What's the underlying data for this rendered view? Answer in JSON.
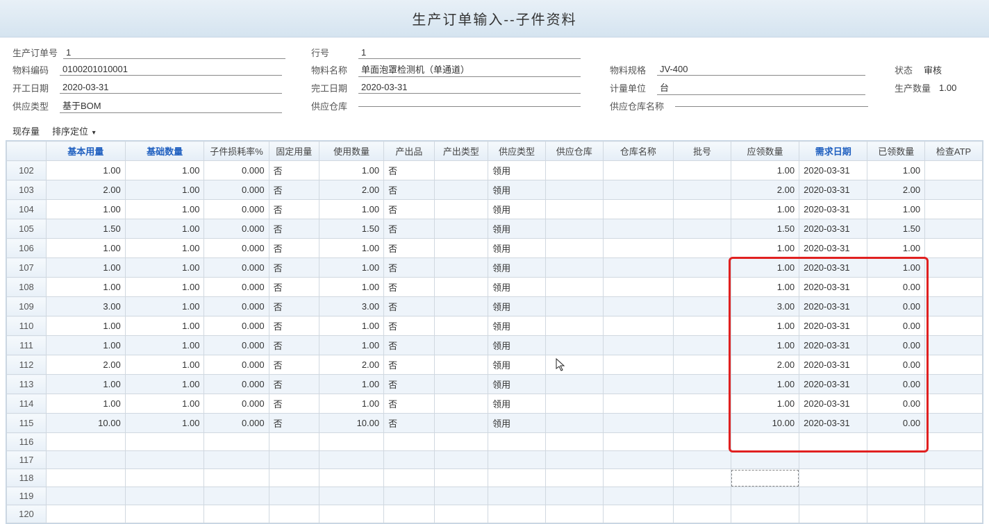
{
  "title": "生产订单输入--子件资料",
  "form": {
    "order_no_label": "生产订单号",
    "order_no": "1",
    "line_no_label": "行号",
    "line_no": "1",
    "mat_code_label": "物料编码",
    "mat_code": "0100201010001",
    "mat_name_label": "物料名称",
    "mat_name": "单面泡罩检测机（单通道）",
    "mat_spec_label": "物料规格",
    "mat_spec": "JV-400",
    "status_label": "状态",
    "status": "审核",
    "start_date_label": "开工日期",
    "start_date": "2020-03-31",
    "end_date_label": "完工日期",
    "end_date": "2020-03-31",
    "unit_label": "计量单位",
    "unit": "台",
    "qty_label": "生产数量",
    "qty": "1.00",
    "supply_type_label": "供应类型",
    "supply_type": "基于BOM",
    "supply_wh_label": "供应仓库",
    "supply_wh": "",
    "supply_wh_name_label": "供应仓库名称",
    "supply_wh_name": ""
  },
  "toolbar": {
    "stock": "现存量",
    "sort": "排序定位"
  },
  "columns": {
    "c0": "",
    "c1": "基本用量",
    "c2": "基础数量",
    "c3": "子件损耗率%",
    "c4": "固定用量",
    "c5": "使用数量",
    "c6": "产出品",
    "c7": "产出类型",
    "c8": "供应类型",
    "c9": "供应仓库",
    "c10": "仓库名称",
    "c11": "批号",
    "c12": "应领数量",
    "c13": "需求日期",
    "c14": "已领数量",
    "c15": "检查ATP"
  },
  "rows": [
    {
      "n": "102",
      "base": "1.00",
      "bqty": "1.00",
      "loss": "0.000",
      "fix": "否",
      "use": "1.00",
      "out": "否",
      "ot": "",
      "st": "领用",
      "wh": "",
      "wn": "",
      "lot": "",
      "req": "1.00",
      "date": "2020-03-31",
      "got": "1.00",
      "atp": ""
    },
    {
      "n": "103",
      "base": "2.00",
      "bqty": "1.00",
      "loss": "0.000",
      "fix": "否",
      "use": "2.00",
      "out": "否",
      "ot": "",
      "st": "领用",
      "wh": "",
      "wn": "",
      "lot": "",
      "req": "2.00",
      "date": "2020-03-31",
      "got": "2.00",
      "atp": ""
    },
    {
      "n": "104",
      "base": "1.00",
      "bqty": "1.00",
      "loss": "0.000",
      "fix": "否",
      "use": "1.00",
      "out": "否",
      "ot": "",
      "st": "领用",
      "wh": "",
      "wn": "",
      "lot": "",
      "req": "1.00",
      "date": "2020-03-31",
      "got": "1.00",
      "atp": ""
    },
    {
      "n": "105",
      "base": "1.50",
      "bqty": "1.00",
      "loss": "0.000",
      "fix": "否",
      "use": "1.50",
      "out": "否",
      "ot": "",
      "st": "领用",
      "wh": "",
      "wn": "",
      "lot": "",
      "req": "1.50",
      "date": "2020-03-31",
      "got": "1.50",
      "atp": ""
    },
    {
      "n": "106",
      "base": "1.00",
      "bqty": "1.00",
      "loss": "0.000",
      "fix": "否",
      "use": "1.00",
      "out": "否",
      "ot": "",
      "st": "领用",
      "wh": "",
      "wn": "",
      "lot": "",
      "req": "1.00",
      "date": "2020-03-31",
      "got": "1.00",
      "atp": ""
    },
    {
      "n": "107",
      "base": "1.00",
      "bqty": "1.00",
      "loss": "0.000",
      "fix": "否",
      "use": "1.00",
      "out": "否",
      "ot": "",
      "st": "领用",
      "wh": "",
      "wn": "",
      "lot": "",
      "req": "1.00",
      "date": "2020-03-31",
      "got": "1.00",
      "atp": ""
    },
    {
      "n": "108",
      "base": "1.00",
      "bqty": "1.00",
      "loss": "0.000",
      "fix": "否",
      "use": "1.00",
      "out": "否",
      "ot": "",
      "st": "领用",
      "wh": "",
      "wn": "",
      "lot": "",
      "req": "1.00",
      "date": "2020-03-31",
      "got": "0.00",
      "atp": ""
    },
    {
      "n": "109",
      "base": "3.00",
      "bqty": "1.00",
      "loss": "0.000",
      "fix": "否",
      "use": "3.00",
      "out": "否",
      "ot": "",
      "st": "领用",
      "wh": "",
      "wn": "",
      "lot": "",
      "req": "3.00",
      "date": "2020-03-31",
      "got": "0.00",
      "atp": ""
    },
    {
      "n": "110",
      "base": "1.00",
      "bqty": "1.00",
      "loss": "0.000",
      "fix": "否",
      "use": "1.00",
      "out": "否",
      "ot": "",
      "st": "领用",
      "wh": "",
      "wn": "",
      "lot": "",
      "req": "1.00",
      "date": "2020-03-31",
      "got": "0.00",
      "atp": ""
    },
    {
      "n": "111",
      "base": "1.00",
      "bqty": "1.00",
      "loss": "0.000",
      "fix": "否",
      "use": "1.00",
      "out": "否",
      "ot": "",
      "st": "领用",
      "wh": "",
      "wn": "",
      "lot": "",
      "req": "1.00",
      "date": "2020-03-31",
      "got": "0.00",
      "atp": ""
    },
    {
      "n": "112",
      "base": "2.00",
      "bqty": "1.00",
      "loss": "0.000",
      "fix": "否",
      "use": "2.00",
      "out": "否",
      "ot": "",
      "st": "领用",
      "wh": "",
      "wn": "",
      "lot": "",
      "req": "2.00",
      "date": "2020-03-31",
      "got": "0.00",
      "atp": ""
    },
    {
      "n": "113",
      "base": "1.00",
      "bqty": "1.00",
      "loss": "0.000",
      "fix": "否",
      "use": "1.00",
      "out": "否",
      "ot": "",
      "st": "领用",
      "wh": "",
      "wn": "",
      "lot": "",
      "req": "1.00",
      "date": "2020-03-31",
      "got": "0.00",
      "atp": ""
    },
    {
      "n": "114",
      "base": "1.00",
      "bqty": "1.00",
      "loss": "0.000",
      "fix": "否",
      "use": "1.00",
      "out": "否",
      "ot": "",
      "st": "领用",
      "wh": "",
      "wn": "",
      "lot": "",
      "req": "1.00",
      "date": "2020-03-31",
      "got": "0.00",
      "atp": ""
    },
    {
      "n": "115",
      "base": "10.00",
      "bqty": "1.00",
      "loss": "0.000",
      "fix": "否",
      "use": "10.00",
      "out": "否",
      "ot": "",
      "st": "领用",
      "wh": "",
      "wn": "",
      "lot": "",
      "req": "10.00",
      "date": "2020-03-31",
      "got": "0.00",
      "atp": ""
    },
    {
      "n": "116",
      "base": "",
      "bqty": "",
      "loss": "",
      "fix": "",
      "use": "",
      "out": "",
      "ot": "",
      "st": "",
      "wh": "",
      "wn": "",
      "lot": "",
      "req": "",
      "date": "",
      "got": "",
      "atp": ""
    },
    {
      "n": "117",
      "base": "",
      "bqty": "",
      "loss": "",
      "fix": "",
      "use": "",
      "out": "",
      "ot": "",
      "st": "",
      "wh": "",
      "wn": "",
      "lot": "",
      "req": "",
      "date": "",
      "got": "",
      "atp": ""
    },
    {
      "n": "118",
      "base": "",
      "bqty": "",
      "loss": "",
      "fix": "",
      "use": "",
      "out": "",
      "ot": "",
      "st": "",
      "wh": "",
      "wn": "",
      "lot": "",
      "req": "",
      "date": "",
      "got": "",
      "atp": ""
    },
    {
      "n": "119",
      "base": "",
      "bqty": "",
      "loss": "",
      "fix": "",
      "use": "",
      "out": "",
      "ot": "",
      "st": "",
      "wh": "",
      "wn": "",
      "lot": "",
      "req": "",
      "date": "",
      "got": "",
      "atp": ""
    },
    {
      "n": "120",
      "base": "",
      "bqty": "",
      "loss": "",
      "fix": "",
      "use": "",
      "out": "",
      "ot": "",
      "st": "",
      "wh": "",
      "wn": "",
      "lot": "",
      "req": "",
      "date": "",
      "got": "",
      "atp": ""
    }
  ],
  "highlight": {
    "row_start_n": "107",
    "row_end_n": "116"
  },
  "dashed_cell": {
    "row_n": "118",
    "col": 12
  }
}
